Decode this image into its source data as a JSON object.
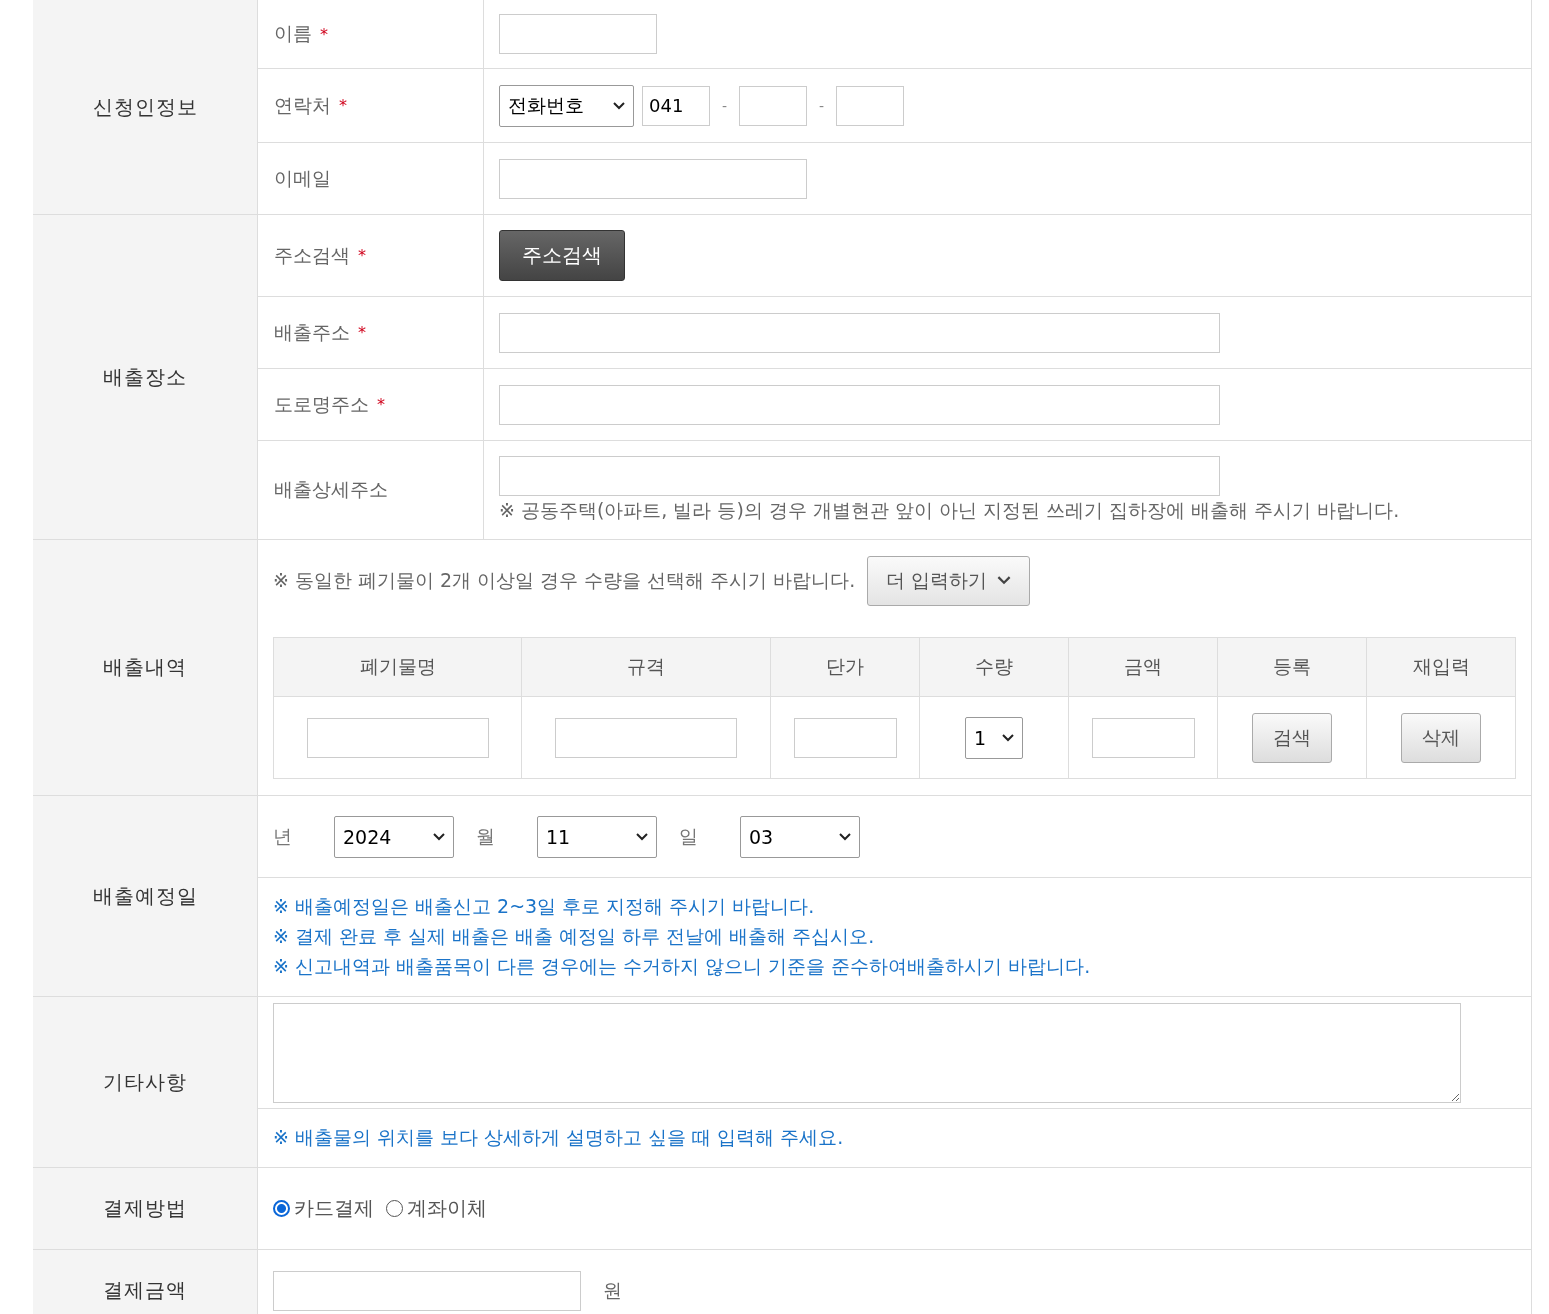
{
  "sections": [
    {
      "kind": "applicant",
      "title": "신청인정보",
      "rows": [
        {
          "kind": "name",
          "label": "이름",
          "required_mark": "*"
        },
        {
          "kind": "phone",
          "label": "연락처",
          "required_mark": "*",
          "select": "전화번호",
          "first": "041",
          "separators": [
            "-",
            "-"
          ]
        },
        {
          "kind": "email",
          "label": "이메일"
        }
      ]
    },
    {
      "kind": "place",
      "title": "배출장소",
      "rows": [
        {
          "kind": "button",
          "label": "주소검색",
          "required_mark": "*",
          "button": "주소검색"
        },
        {
          "kind": "wide",
          "label": "배출주소",
          "required_mark": "*"
        },
        {
          "kind": "wide",
          "label": "도로명주소",
          "required_mark": "*"
        },
        {
          "kind": "wide-note",
          "label": "배출상세주소",
          "note": "※ 공동주택(아파트, 빌라 등)의 경우 개별현관 앞이 아닌 지정된 쓰레기 집하장에 배출해 주시기 바랍니다."
        }
      ]
    },
    {
      "kind": "waste",
      "title": "배출내역",
      "note": "※ 동일한 폐기물이 2개 이상일 경우 수량을 선택해 주시기 바랍니다.",
      "more_button": "더 입력하기",
      "columns": [
        "폐기물명",
        "규격",
        "단가",
        "수량",
        "금액",
        "등록",
        "재입력"
      ],
      "cells": [
        {
          "kind": "input"
        },
        {
          "kind": "input"
        },
        {
          "kind": "input-small"
        },
        {
          "kind": "select",
          "value": "1"
        },
        {
          "kind": "input-small"
        },
        {
          "kind": "button",
          "label": "검색"
        },
        {
          "kind": "button",
          "label": "삭제"
        }
      ]
    },
    {
      "kind": "date",
      "title": "배출예정일",
      "parts": [
        {
          "label": "년",
          "value": "2024"
        },
        {
          "label": "월",
          "value": "11"
        },
        {
          "label": "일",
          "value": "03"
        }
      ],
      "notes": [
        "※ 배출예정일은 배출신고 2~3일 후로 지정해 주시기 바랍니다.",
        "※ 결제 완료 후 실제 배출은 배출 예정일 하루 전날에 배출해 주십시오.",
        "※ 신고내역과 배출품목이 다른 경우에는 수거하지 않으니 기준을 준수하여배출하시기 바랍니다."
      ]
    },
    {
      "kind": "memo",
      "title": "기타사항",
      "note": "※ 배출물의 위치를 보다 상세하게 설명하고 싶을 때 입력해 주세요."
    },
    {
      "kind": "payment",
      "title": "결제방법",
      "options": [
        {
          "label": "카드결제",
          "selected": true
        },
        {
          "label": "계좌이체",
          "selected": false
        }
      ]
    },
    {
      "kind": "amount",
      "title": "결제금액",
      "unit": "원"
    }
  ]
}
